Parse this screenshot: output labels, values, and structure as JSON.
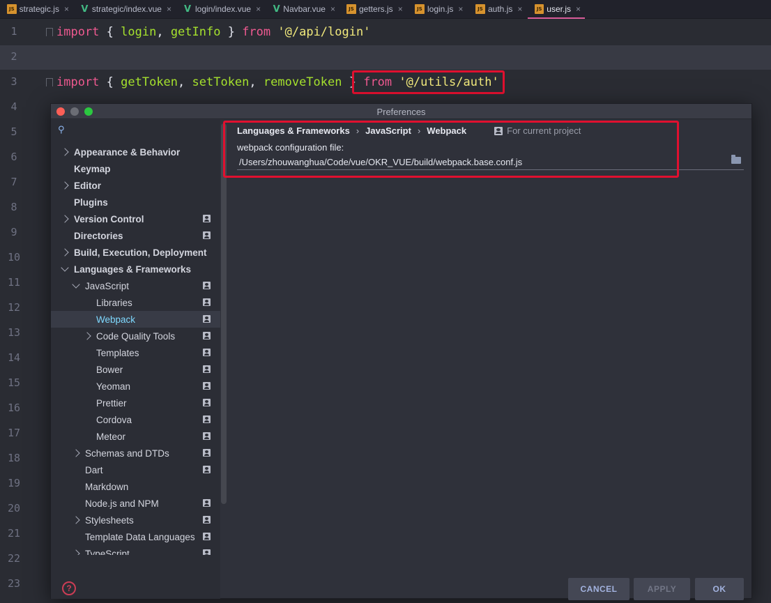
{
  "tabs": [
    {
      "label": "strategic.js",
      "type": "js",
      "active": false
    },
    {
      "label": "strategic/index.vue",
      "type": "vue",
      "active": false
    },
    {
      "label": "login/index.vue",
      "type": "vue",
      "active": false
    },
    {
      "label": "Navbar.vue",
      "type": "vue",
      "active": false
    },
    {
      "label": "getters.js",
      "type": "js",
      "active": false
    },
    {
      "label": "login.js",
      "type": "js",
      "active": false
    },
    {
      "label": "auth.js",
      "type": "js",
      "active": false
    },
    {
      "label": "user.js",
      "type": "js",
      "active": true
    }
  ],
  "tab_icon_js": "JS",
  "tab_icon_vue": "V",
  "tab_close": "×",
  "gutter": {
    "line_numbers": [
      "1",
      "2",
      "3",
      "4",
      "5",
      "6",
      "7",
      "8",
      "9",
      "10",
      "11",
      "12",
      "13",
      "14",
      "15",
      "16",
      "17",
      "18",
      "19",
      "20",
      "21",
      "22",
      "23"
    ]
  },
  "code": {
    "line1": [
      {
        "t": "import",
        "c": "kw"
      },
      {
        "t": " { ",
        "c": "pn"
      },
      {
        "t": "login",
        "c": "id"
      },
      {
        "t": ", ",
        "c": "pn"
      },
      {
        "t": "getInfo",
        "c": "id"
      },
      {
        "t": " } ",
        "c": "pn"
      },
      {
        "t": "from",
        "c": "kw"
      },
      {
        "t": " ",
        "c": "pn"
      },
      {
        "t": "'@/api/login'",
        "c": "str"
      }
    ],
    "line3": [
      {
        "t": "import",
        "c": "kw"
      },
      {
        "t": " { ",
        "c": "pn"
      },
      {
        "t": "getToken",
        "c": "id"
      },
      {
        "t": ", ",
        "c": "pn"
      },
      {
        "t": "setToken",
        "c": "id"
      },
      {
        "t": ", ",
        "c": "pn"
      },
      {
        "t": "removeToken",
        "c": "id"
      },
      {
        "t": " } ",
        "c": "pn"
      },
      {
        "t": "from",
        "c": "kw"
      },
      {
        "t": " ",
        "c": "pn"
      },
      {
        "t": "'@/utils/auth'",
        "c": "str"
      }
    ]
  },
  "dialog": {
    "title": "Preferences",
    "search_icon": "⚲",
    "tree": [
      {
        "label": "Appearance & Behavior",
        "level": 0,
        "arrow": "right",
        "bold": true,
        "proj": false
      },
      {
        "label": "Keymap",
        "level": 0,
        "arrow": "none",
        "bold": true,
        "proj": false
      },
      {
        "label": "Editor",
        "level": 0,
        "arrow": "right",
        "bold": true,
        "proj": false
      },
      {
        "label": "Plugins",
        "level": 0,
        "arrow": "none",
        "bold": true,
        "proj": false
      },
      {
        "label": "Version Control",
        "level": 0,
        "arrow": "right",
        "bold": true,
        "proj": true
      },
      {
        "label": "Directories",
        "level": 0,
        "arrow": "none",
        "bold": true,
        "proj": true
      },
      {
        "label": "Build, Execution, Deployment",
        "level": 0,
        "arrow": "right",
        "bold": true,
        "proj": false
      },
      {
        "label": "Languages & Frameworks",
        "level": 0,
        "arrow": "down",
        "bold": true,
        "proj": false
      },
      {
        "label": "JavaScript",
        "level": 1,
        "arrow": "down",
        "bold": false,
        "proj": true
      },
      {
        "label": "Libraries",
        "level": 2,
        "arrow": "none",
        "bold": false,
        "proj": true
      },
      {
        "label": "Webpack",
        "level": 2,
        "arrow": "none",
        "bold": false,
        "proj": true,
        "selected": true
      },
      {
        "label": "Code Quality Tools",
        "level": 2,
        "arrow": "right",
        "bold": false,
        "proj": true
      },
      {
        "label": "Templates",
        "level": 2,
        "arrow": "none",
        "bold": false,
        "proj": true
      },
      {
        "label": "Bower",
        "level": 2,
        "arrow": "none",
        "bold": false,
        "proj": true
      },
      {
        "label": "Yeoman",
        "level": 2,
        "arrow": "none",
        "bold": false,
        "proj": true
      },
      {
        "label": "Prettier",
        "level": 2,
        "arrow": "none",
        "bold": false,
        "proj": true
      },
      {
        "label": "Cordova",
        "level": 2,
        "arrow": "none",
        "bold": false,
        "proj": true
      },
      {
        "label": "Meteor",
        "level": 2,
        "arrow": "none",
        "bold": false,
        "proj": true
      },
      {
        "label": "Schemas and DTDs",
        "level": 1,
        "arrow": "right",
        "bold": false,
        "proj": true
      },
      {
        "label": "Dart",
        "level": 1,
        "arrow": "none",
        "bold": false,
        "proj": true
      },
      {
        "label": "Markdown",
        "level": 1,
        "arrow": "none",
        "bold": false,
        "proj": false
      },
      {
        "label": "Node.js and NPM",
        "level": 1,
        "arrow": "none",
        "bold": false,
        "proj": true
      },
      {
        "label": "Stylesheets",
        "level": 1,
        "arrow": "right",
        "bold": false,
        "proj": true
      },
      {
        "label": "Template Data Languages",
        "level": 1,
        "arrow": "none",
        "bold": false,
        "proj": true
      },
      {
        "label": "TypeScript",
        "level": 1,
        "arrow": "right",
        "bold": false,
        "proj": true
      }
    ],
    "breadcrumb": [
      "Languages & Frameworks",
      "JavaScript",
      "Webpack"
    ],
    "breadcrumb_sep": "›",
    "scope_label": "For current project",
    "config_label": "webpack configuration file:",
    "config_value": "/Users/zhouwanghua/Code/vue/OKR_VUE/build/webpack.base.conf.js",
    "help_label": "?",
    "buttons": {
      "cancel": "CANCEL",
      "apply": "APPLY",
      "ok": "OK"
    }
  }
}
